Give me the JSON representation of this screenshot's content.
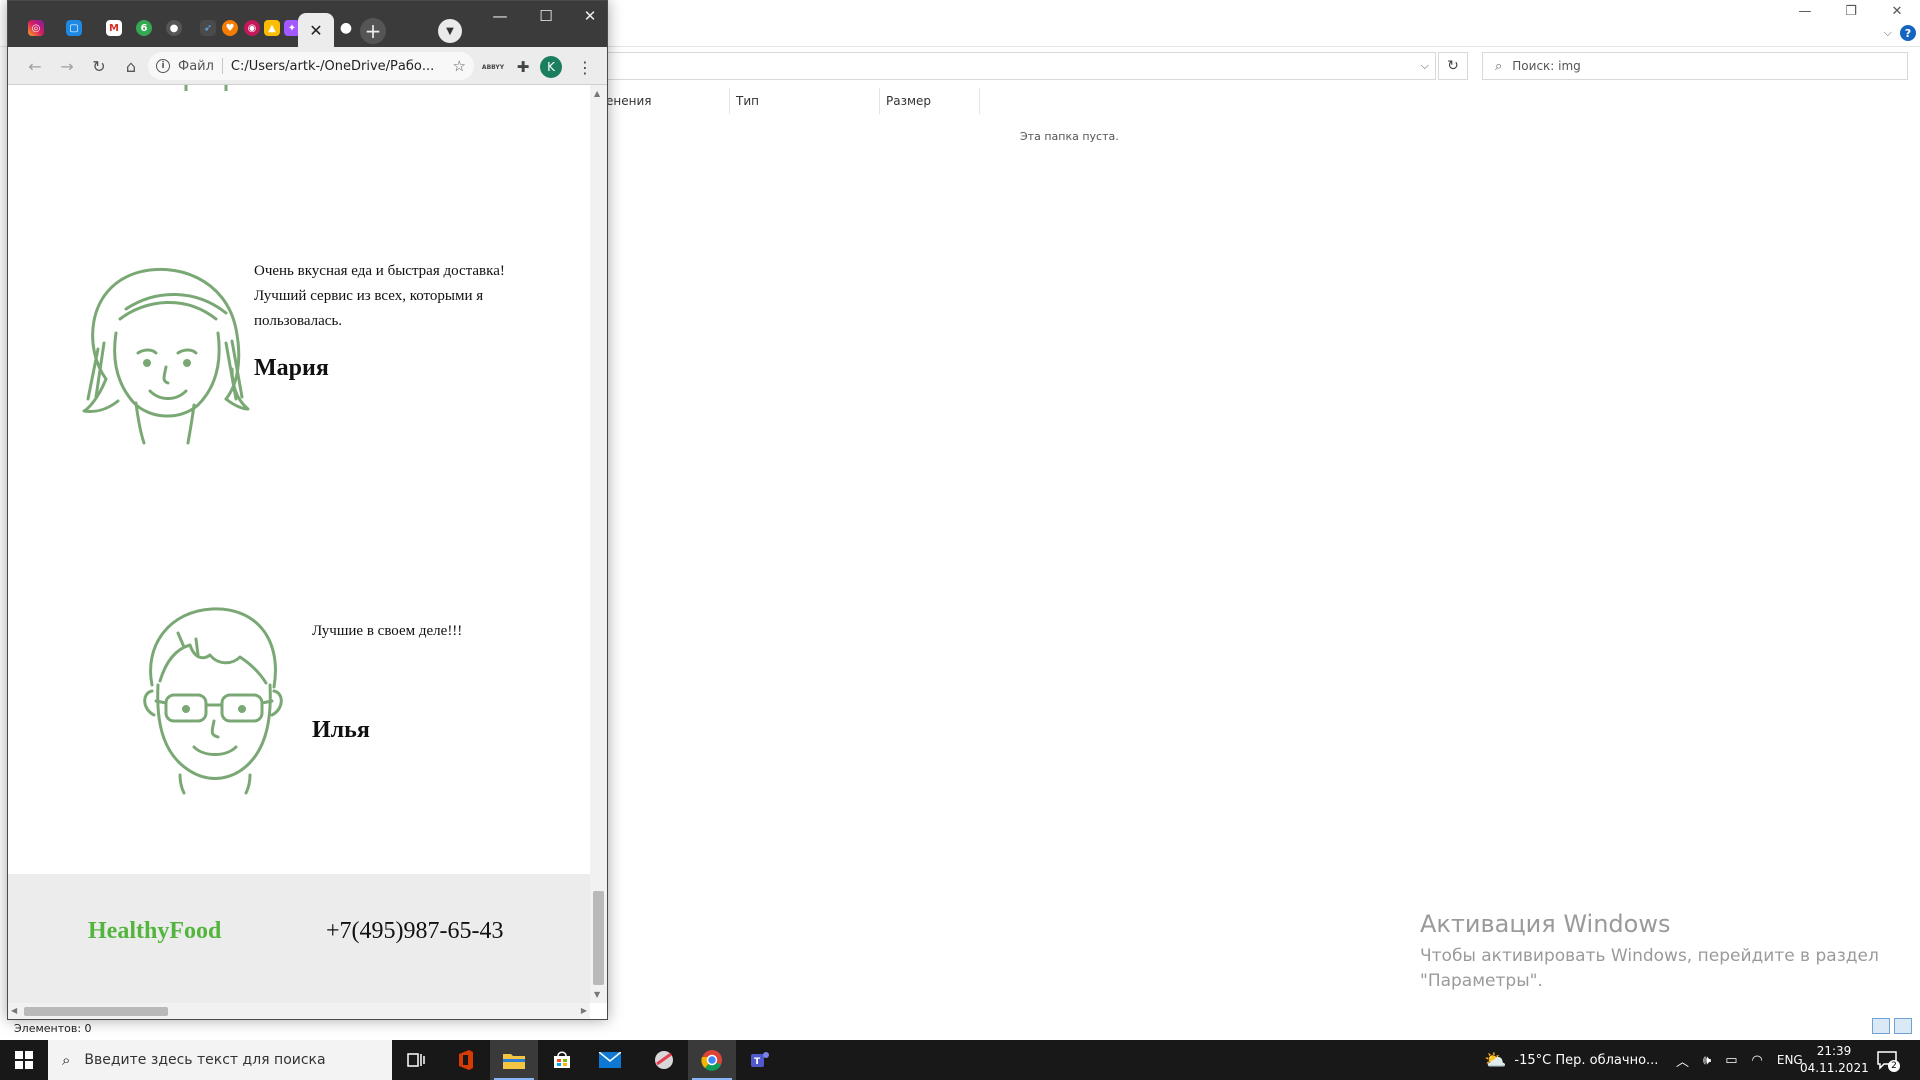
{
  "explorer": {
    "columns": [
      "енения",
      "Тип",
      "Размер"
    ],
    "empty_text": "Эта папка пуста.",
    "search_placeholder": "Поиск: img",
    "status": "Элементов: 0"
  },
  "activation": {
    "title": "Активация Windows",
    "line1": "Чтобы активировать Windows, перейдите в раздел",
    "line2": "\"Параметры\"."
  },
  "browser": {
    "scheme_label": "Файл",
    "url": "C:/Users/artk-/OneDrive/Рабо...",
    "profile_initial": "K",
    "ext_label": "ABBYY"
  },
  "page": {
    "reviews": [
      {
        "quote_lines": [
          "Очень вкусная еда и быстрая доставка!",
          "Лучший сервис из всех, которыми я",
          "пользовалась."
        ],
        "name": "Мария"
      },
      {
        "quote_lines": [
          "Лучшие в своем деле!!!"
        ],
        "name": "Илья"
      }
    ],
    "footer": {
      "brand": "HealthyFood",
      "phone": "+7(495)987-65-43"
    },
    "accent_color": "#53b53d",
    "illustration_color": "#7aa874"
  },
  "taskbar": {
    "search_placeholder": "Введите здесь текст для поиска",
    "weather": "-15°C  Пер. облачно...",
    "lang": "ENG",
    "time": "21:39",
    "date": "04.11.2021",
    "notifications": "2"
  }
}
